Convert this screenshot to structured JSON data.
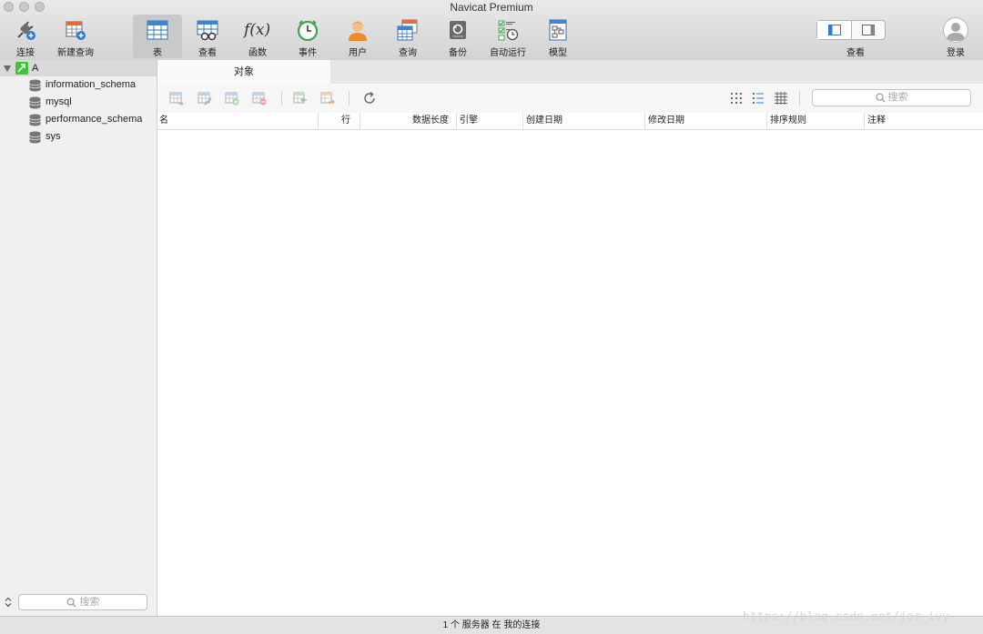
{
  "window": {
    "title": "Navicat Premium"
  },
  "toolbar": {
    "items": [
      {
        "label": "连接",
        "icon": "plug-icon"
      },
      {
        "label": "新建查询",
        "icon": "new-query-icon"
      },
      {
        "label": "表",
        "icon": "table-icon"
      },
      {
        "label": "查看",
        "icon": "view-icon"
      },
      {
        "label": "函数",
        "icon": "function-icon"
      },
      {
        "label": "事件",
        "icon": "clock-icon"
      },
      {
        "label": "用户",
        "icon": "user-icon"
      },
      {
        "label": "查询",
        "icon": "query-icon"
      },
      {
        "label": "备份",
        "icon": "backup-icon"
      },
      {
        "label": "自动运行",
        "icon": "automation-icon"
      },
      {
        "label": "模型",
        "icon": "model-icon"
      }
    ],
    "active": "表",
    "view_label": "查看",
    "login_label": "登录",
    "function_glyph": "f(x)"
  },
  "sidebar": {
    "connection": "A",
    "databases": [
      "information_schema",
      "mysql",
      "performance_schema",
      "sys"
    ],
    "search_placeholder": "搜索"
  },
  "main": {
    "tab": "对象",
    "search_placeholder": "搜索",
    "columns": [
      "名",
      "行",
      "数据长度",
      "引擎",
      "创建日期",
      "修改日期",
      "排序规则",
      "注释"
    ]
  },
  "status": {
    "text": "1 个 服务器 在 我的连接"
  },
  "watermark": "https://blog.csdn.net/jor_ivy",
  "colors": {
    "accent": "#2e7bd6",
    "connection": "#3cc53a"
  }
}
